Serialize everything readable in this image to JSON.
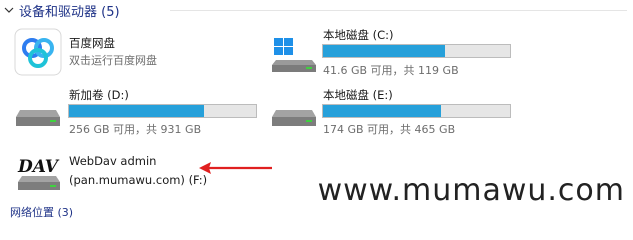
{
  "section": {
    "title": "设备和驱动器 (5)"
  },
  "drives": [
    {
      "name": "百度网盘",
      "subtitle": "双击运行百度网盘",
      "icon": "baidu-netdisk-icon"
    },
    {
      "name": "本地磁盘 (C:)",
      "space": "41.6 GB 可用，共 119 GB",
      "used_fraction": 0.65,
      "icon": "windows-drive-icon"
    },
    {
      "name": "新加卷 (D:)",
      "space": "256 GB 可用，共 931 GB",
      "used_fraction": 0.72,
      "icon": "hard-drive-icon"
    },
    {
      "name": "本地磁盘 (E:)",
      "space": "174 GB 可用，共 465 GB",
      "used_fraction": 0.63,
      "icon": "hard-drive-icon"
    }
  ],
  "network_drive": {
    "line1": "WebDav admin",
    "line2": "(pan.mumawu.com) (F:)",
    "icon": "dav-network-drive-icon"
  },
  "annotation": {
    "icon": "red-arrow-icon",
    "color": "#e02020"
  },
  "watermark": "www.mumawu.com",
  "next_section": {
    "title": "网络位置 (3)"
  },
  "colors": {
    "bar_fill": "#26a0da",
    "bar_bg": "#e6e6e6",
    "header_text": "#1e3287"
  }
}
